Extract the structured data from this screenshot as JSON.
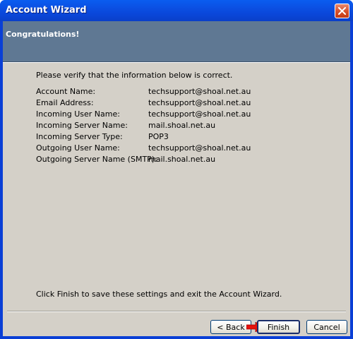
{
  "window": {
    "title": "Account Wizard"
  },
  "banner": {
    "title": "Congratulations!"
  },
  "content": {
    "intro": "Please verify that the information below is correct.",
    "rows": [
      {
        "label": "Account Name:",
        "value": "techsupport@shoal.net.au"
      },
      {
        "label": "Email Address:",
        "value": "techsupport@shoal.net.au"
      },
      {
        "label": "Incoming User Name:",
        "value": "techsupport@shoal.net.au"
      },
      {
        "label": "Incoming Server Name:",
        "value": "mail.shoal.net.au"
      },
      {
        "label": "Incoming Server Type:",
        "value": "POP3"
      },
      {
        "label": "Outgoing User Name:",
        "value": "techsupport@shoal.net.au"
      },
      {
        "label": "Outgoing Server Name (SMTP):",
        "value": "mail.shoal.net.au"
      }
    ],
    "outro": "Click Finish to save these settings and exit the Account Wizard."
  },
  "buttons": {
    "back": "< Back",
    "finish": "Finish",
    "cancel": "Cancel"
  },
  "colors": {
    "title_bar": "#0a4fe2",
    "banner": "#5f7893",
    "dialog_bg": "#d4d0c8",
    "pointer_arrow": "#e8120c"
  },
  "icons": {
    "close": "close-icon",
    "pointer": "red-arrow-icon"
  }
}
